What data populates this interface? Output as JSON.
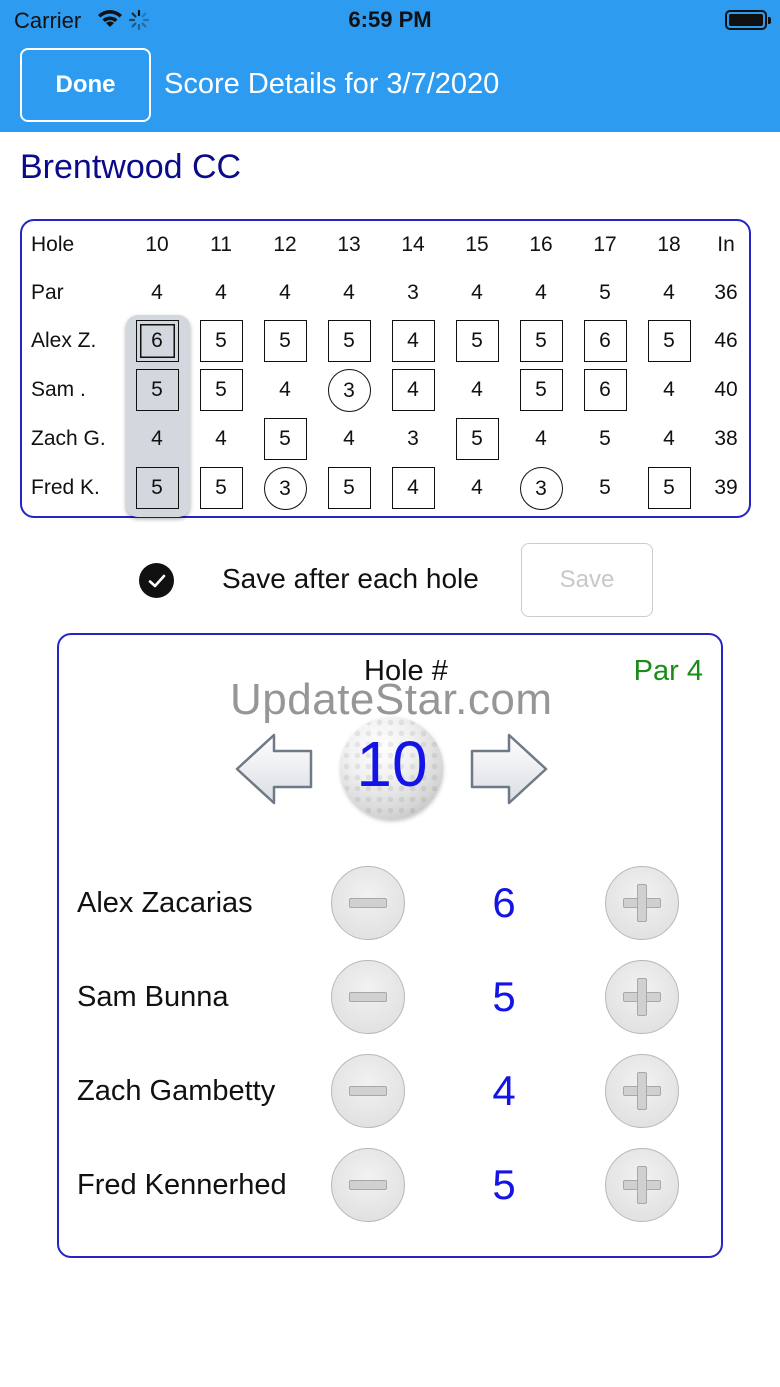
{
  "status_bar": {
    "carrier": "Carrier",
    "time": "6:59 PM"
  },
  "header": {
    "done_label": "Done",
    "title": "Score Details for 3/7/2020"
  },
  "course_name": "Brentwood CC",
  "scorecard": {
    "hole_label": "Hole",
    "par_label": "Par",
    "holes": [
      "10",
      "11",
      "12",
      "13",
      "14",
      "15",
      "16",
      "17",
      "18"
    ],
    "in_label": "In",
    "pars": [
      "4",
      "4",
      "4",
      "4",
      "3",
      "4",
      "4",
      "5",
      "4"
    ],
    "par_total": "36",
    "players": [
      {
        "short": "Alex Z.",
        "scores": [
          "6",
          "5",
          "5",
          "5",
          "4",
          "5",
          "5",
          "6",
          "5"
        ],
        "marks": [
          "double-box",
          "box",
          "box",
          "box",
          "box",
          "box",
          "box",
          "box",
          "box"
        ],
        "total": "46"
      },
      {
        "short": "Sam  .",
        "scores": [
          "5",
          "5",
          "4",
          "3",
          "4",
          "4",
          "5",
          "6",
          "4"
        ],
        "marks": [
          "box",
          "box",
          "none",
          "circle",
          "box",
          "none",
          "box",
          "box",
          "none"
        ],
        "total": "40"
      },
      {
        "short": "Zach G.",
        "scores": [
          "4",
          "4",
          "5",
          "4",
          "3",
          "5",
          "4",
          "5",
          "4"
        ],
        "marks": [
          "none",
          "none",
          "box",
          "none",
          "none",
          "box",
          "none",
          "none",
          "none"
        ],
        "total": "38"
      },
      {
        "short": "Fred K.",
        "scores": [
          "5",
          "5",
          "3",
          "5",
          "4",
          "4",
          "3",
          "5",
          "5"
        ],
        "marks": [
          "box",
          "box",
          "circle",
          "box",
          "box",
          "none",
          "circle",
          "none",
          "box"
        ],
        "total": "39"
      }
    ],
    "selected_hole": "10"
  },
  "save_row": {
    "checkbox_checked": true,
    "label": "Save after each hole",
    "save_label": "Save"
  },
  "entry": {
    "hole_label": "Hole #",
    "par_label": "Par 4",
    "hole_number": "10",
    "watermark": "UpdateStar.com",
    "players": [
      {
        "name": "Alex Zacarias",
        "score": "6"
      },
      {
        "name": "Sam  Bunna",
        "score": "5"
      },
      {
        "name": "Zach Gambetty",
        "score": "4"
      },
      {
        "name": "Fred Kennerhed",
        "score": "5"
      }
    ]
  },
  "colors": {
    "header_bg": "#2d9bf0",
    "panel_border": "#2424c8",
    "score_blue": "#1414e6",
    "par_green": "#1a8c1a",
    "course_navy": "#0a0a8a"
  }
}
